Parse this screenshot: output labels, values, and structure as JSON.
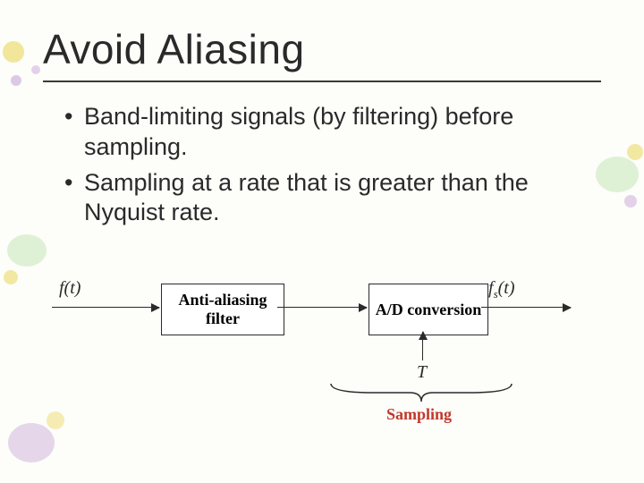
{
  "title": "Avoid Aliasing",
  "bullets": [
    "Band-limiting signals (by filtering) before sampling.",
    "Sampling at a rate that is greater than the Nyquist rate."
  ],
  "diagram": {
    "input_signal": "f(t)",
    "box1": "Anti-aliasing filter",
    "box2": "A/D conversion",
    "output_signal_prefix": "f",
    "output_signal_sub": "s",
    "output_signal_suffix": "(t)",
    "period_label": "T",
    "sampling_label": "Sampling"
  }
}
